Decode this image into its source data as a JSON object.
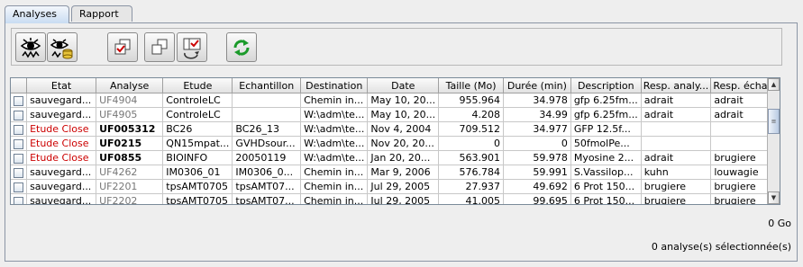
{
  "tabs": [
    {
      "label": "Analyses",
      "active": true
    },
    {
      "label": "Rapport",
      "active": false
    }
  ],
  "toolbar": {
    "buttons": [
      {
        "icon": "eye-analysis-icon"
      },
      {
        "icon": "eye-database-icon"
      },
      {
        "icon": "select-documents-icon"
      },
      {
        "icon": "copy-documents-icon"
      },
      {
        "icon": "refresh-selection-icon"
      },
      {
        "icon": "refresh-icon"
      }
    ]
  },
  "table": {
    "columns": [
      "",
      "Etat",
      "Analyse",
      "Etude",
      "Echantillon",
      "Destination",
      "Date",
      "Taille (Mo)",
      "Durée (min)",
      "Description",
      "Resp. analy...",
      "Resp. écha..."
    ],
    "rows": [
      {
        "etat": "sauvegard...",
        "analyse": "UF4904",
        "etude": "ControleLC",
        "echantillon": "",
        "destination": "Chemin in...",
        "date": "May 10, 20...",
        "taille": "955.964",
        "duree": "34.978",
        "description": "gfp 6.25fm...",
        "resp_analyse": "adrait",
        "resp_echantillon": "adrait",
        "style": "normal"
      },
      {
        "etat": "sauvegard...",
        "analyse": "UF4905",
        "etude": "ControleLC",
        "echantillon": "",
        "destination": "W:\\adm\\te...",
        "date": "May 10, 20...",
        "taille": "4.208",
        "duree": "34.99",
        "description": "gfp 6.25fm...",
        "resp_analyse": "adrait",
        "resp_echantillon": "adrait",
        "style": "normal"
      },
      {
        "etat": "Etude Close",
        "analyse": "UF005312",
        "etude": "BC26",
        "echantillon": "BC26_13",
        "destination": "W:\\adm\\te...",
        "date": "Nov 4, 2004",
        "taille": "709.512",
        "duree": "34.977",
        "description": "GFP 12.5f...",
        "resp_analyse": "",
        "resp_echantillon": "",
        "style": "closed"
      },
      {
        "etat": "Etude Close",
        "analyse": "UF0215",
        "etude": "QN15mpat...",
        "echantillon": "GVHDsour...",
        "destination": "W:\\adm\\te...",
        "date": "Nov 20, 20...",
        "taille": "0",
        "duree": "0",
        "description": "50fmolPe...",
        "resp_analyse": "",
        "resp_echantillon": "",
        "style": "closed"
      },
      {
        "etat": "Etude Close",
        "analyse": "UF0855",
        "etude": "BIOINFO",
        "echantillon": "20050119",
        "destination": "W:\\adm\\te...",
        "date": "Jan 20, 20...",
        "taille": "563.901",
        "duree": "59.978",
        "description": "Myosine 2...",
        "resp_analyse": "adrait",
        "resp_echantillon": "brugiere",
        "style": "closed"
      },
      {
        "etat": "sauvegard...",
        "analyse": "UF4262",
        "etude": "IM0306_01",
        "echantillon": "IM0306_0...",
        "destination": "Chemin in...",
        "date": "Mar 9, 2006",
        "taille": "576.784",
        "duree": "59.991",
        "description": "S.Vassilop...",
        "resp_analyse": "kuhn",
        "resp_echantillon": "louwagie",
        "style": "normal"
      },
      {
        "etat": "sauvegard...",
        "analyse": "UF2201",
        "etude": "tpsAMT0705",
        "echantillon": "tpsAMT07...",
        "destination": "Chemin in...",
        "date": "Jul 29, 2005",
        "taille": "27.937",
        "duree": "49.692",
        "description": "6 Prot 150...",
        "resp_analyse": "brugiere",
        "resp_echantillon": "brugiere",
        "style": "normal"
      },
      {
        "etat": "sauvegard...",
        "analyse": "UF2202",
        "etude": "tpsAMT0705",
        "echantillon": "tpsAMT07...",
        "destination": "Chemin in...",
        "date": "Jul 29, 2005",
        "taille": "41.005",
        "duree": "99.695",
        "description": "6 Prot 150...",
        "resp_analyse": "brugiere",
        "resp_echantillon": "brugiere",
        "style": "normal"
      }
    ]
  },
  "status": {
    "total_size": "0 Go",
    "selected_count": "0 analyse(s) sélectionnée(s)"
  },
  "colors": {
    "closed": "#cc0000",
    "analyse_id": "#777777",
    "refresh": "#1a9a2a"
  }
}
